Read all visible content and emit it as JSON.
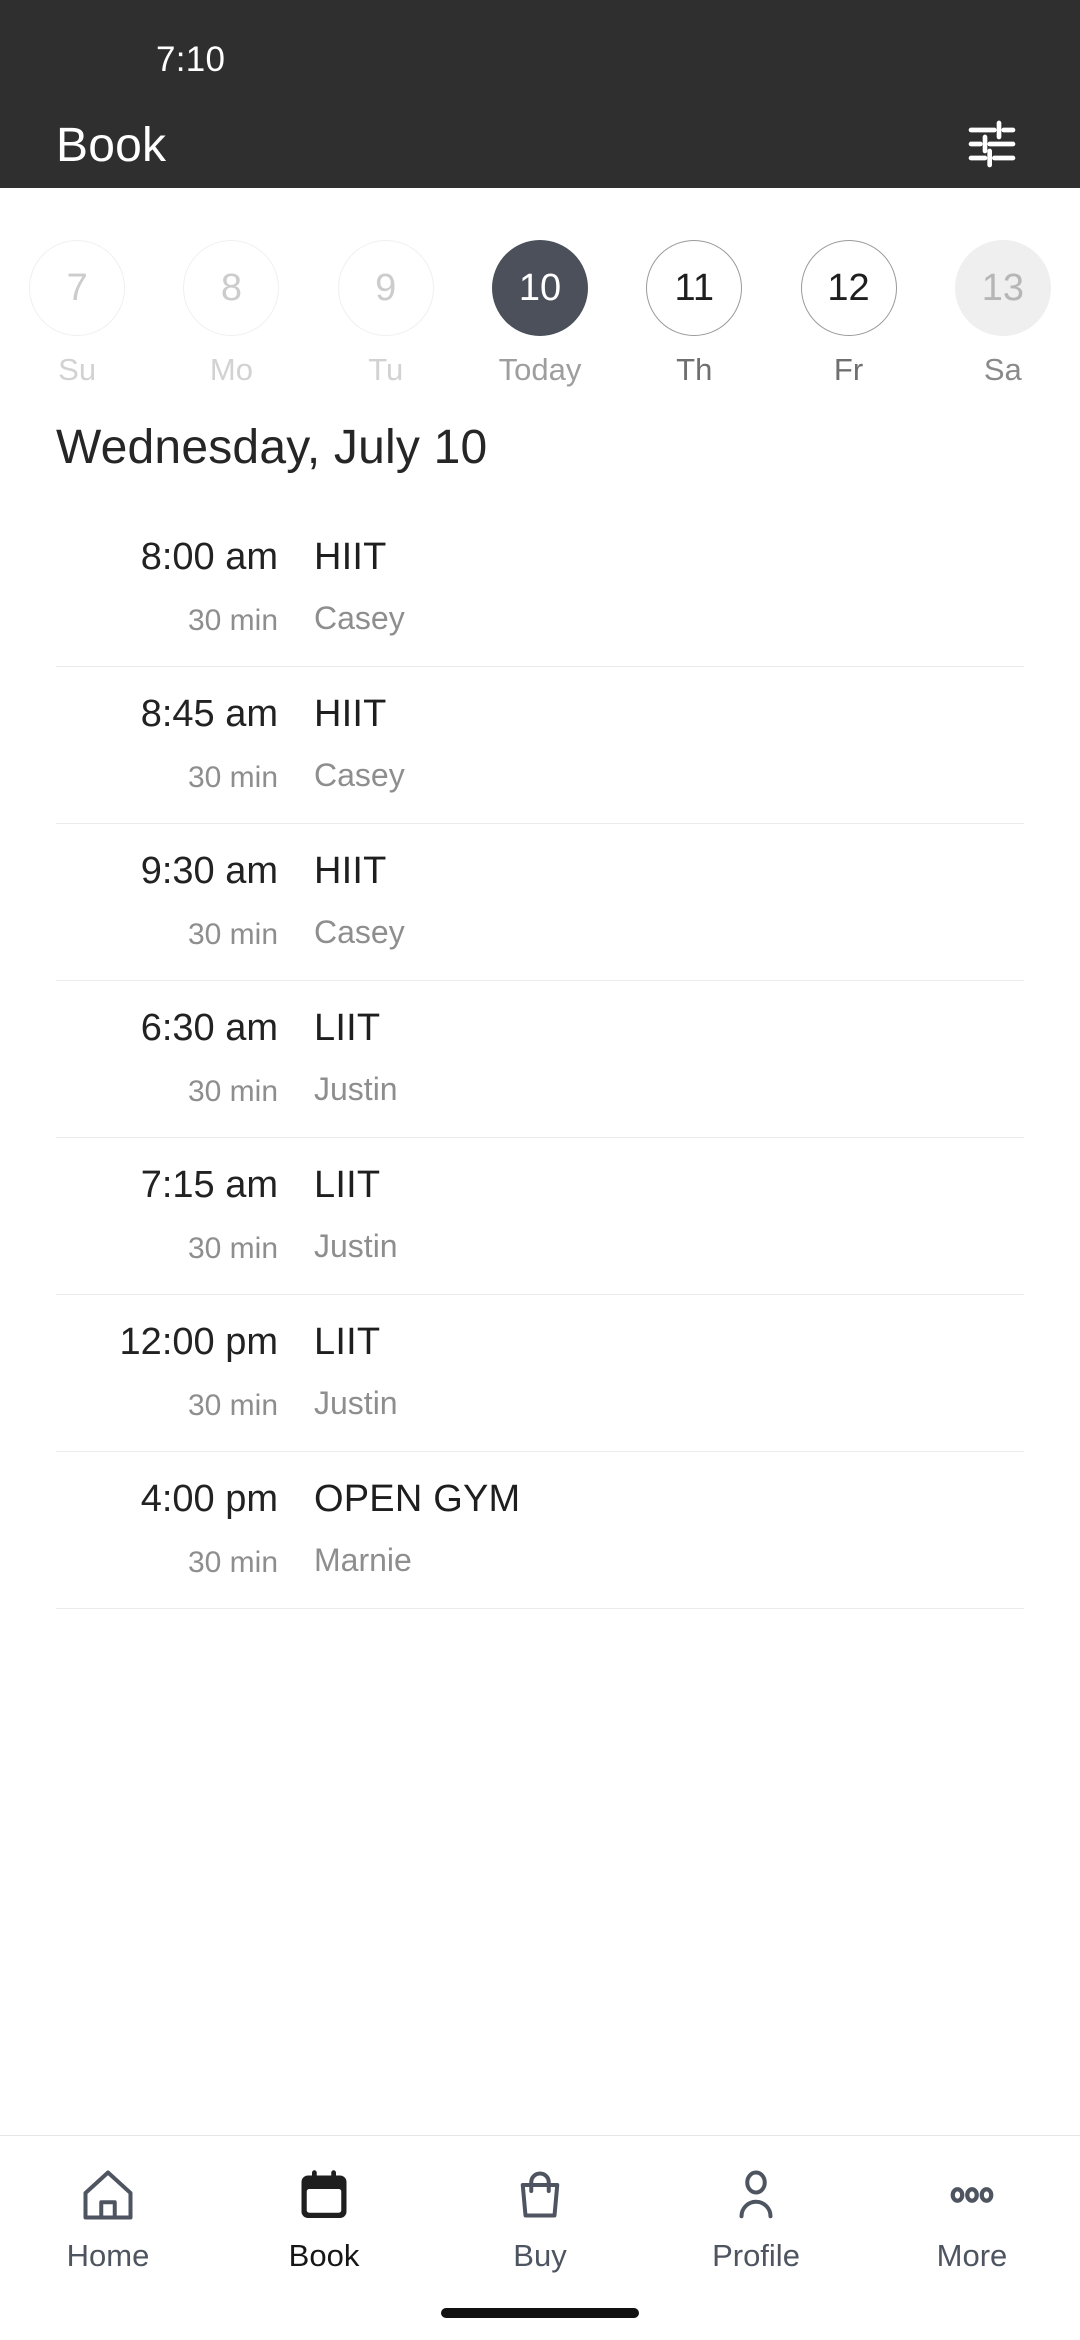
{
  "statusbar": {
    "time": "7:10"
  },
  "header": {
    "title": "Book",
    "filter_icon": "sliders-icon",
    "bg_color": "#2f2f2f"
  },
  "date_strip": {
    "days": [
      {
        "number": "7",
        "weekday": "Su",
        "state": "past"
      },
      {
        "number": "8",
        "weekday": "Mo",
        "state": "past"
      },
      {
        "number": "9",
        "weekday": "Tu",
        "state": "past"
      },
      {
        "number": "10",
        "weekday": "Today",
        "state": "selected"
      },
      {
        "number": "11",
        "weekday": "Th",
        "state": "available"
      },
      {
        "number": "12",
        "weekday": "Fr",
        "state": "available"
      },
      {
        "number": "13",
        "weekday": "Sa",
        "state": "muted"
      }
    ],
    "selected_color": "#4b505b"
  },
  "day_heading": "Wednesday, July 10",
  "classes": [
    {
      "time": "8:00 am",
      "duration": "30 min",
      "name": "HIIT",
      "instructor": "Casey"
    },
    {
      "time": "8:45 am",
      "duration": "30 min",
      "name": "HIIT",
      "instructor": "Casey"
    },
    {
      "time": "9:30 am",
      "duration": "30 min",
      "name": "HIIT",
      "instructor": "Casey"
    },
    {
      "time": "6:30 am",
      "duration": "30 min",
      "name": "LIIT",
      "instructor": "Justin"
    },
    {
      "time": "7:15 am",
      "duration": "30 min",
      "name": "LIIT",
      "instructor": "Justin"
    },
    {
      "time": "12:00 pm",
      "duration": "30 min",
      "name": "LIIT",
      "instructor": "Justin"
    },
    {
      "time": "4:00 pm",
      "duration": "30 min",
      "name": "OPEN GYM",
      "instructor": "Marnie"
    }
  ],
  "bottom_nav": {
    "items": [
      {
        "label": "Home",
        "icon": "home-icon",
        "active": false
      },
      {
        "label": "Book",
        "icon": "calendar-icon",
        "active": true
      },
      {
        "label": "Buy",
        "icon": "bag-icon",
        "active": false
      },
      {
        "label": "Profile",
        "icon": "person-icon",
        "active": false
      },
      {
        "label": "More",
        "icon": "ellipsis-icon",
        "active": false
      }
    ]
  }
}
